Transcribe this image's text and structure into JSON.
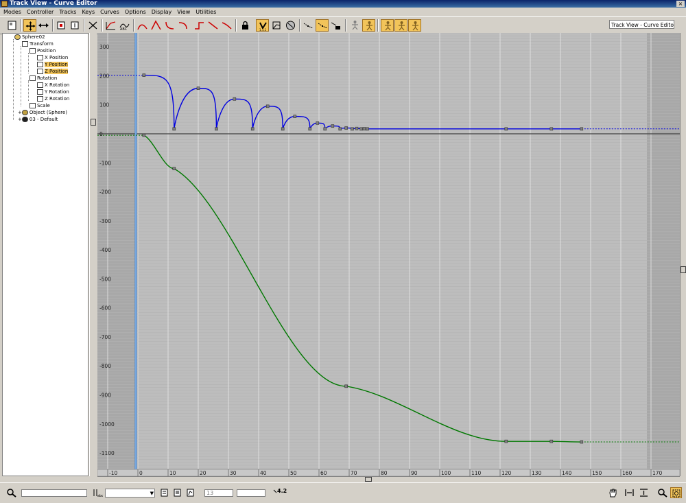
{
  "window": {
    "title": "Track View - Curve Editor",
    "close_glyph": "×"
  },
  "menu": [
    "Modes",
    "Controller",
    "Tracks",
    "Keys",
    "Curves",
    "Options",
    "Display",
    "View",
    "Utilities"
  ],
  "toolbar": {
    "view_name": "Track View - Curve Editor"
  },
  "tree": {
    "nodes": [
      {
        "label": "Sphere02",
        "icon": "object-icon"
      },
      {
        "label": "Transform",
        "icon": "transform-icon"
      },
      {
        "label": "Position",
        "icon": "position-icon"
      },
      {
        "label": "X Position",
        "icon": "track-icon"
      },
      {
        "label": "Y Position",
        "icon": "track-icon",
        "selected": true
      },
      {
        "label": "Z Position",
        "icon": "track-icon",
        "selected": true
      },
      {
        "label": "Rotation",
        "icon": "rotation-icon"
      },
      {
        "label": "X Rotation",
        "icon": "track-icon"
      },
      {
        "label": "Y Rotation",
        "icon": "track-icon"
      },
      {
        "label": "Z Rotation",
        "icon": "track-icon"
      },
      {
        "label": "Scale",
        "icon": "scale-icon"
      },
      {
        "label": "Object (Sphere)",
        "icon": "sphere-icon"
      },
      {
        "label": "03 - Default",
        "icon": "material-icon"
      }
    ]
  },
  "graph": {
    "x_ticks": [
      -10,
      0,
      10,
      20,
      30,
      40,
      50,
      60,
      70,
      80,
      90,
      100,
      110,
      120,
      130,
      140,
      150,
      160,
      170
    ],
    "y_ticks": [
      300,
      200,
      100,
      0,
      -100,
      -200,
      -300,
      -400,
      -500,
      -600,
      -700,
      -800,
      -900,
      -1000,
      -1100
    ],
    "current_frame": 0,
    "active_range": [
      0,
      170
    ],
    "colors": {
      "z_curve": "#0000e0",
      "y_curve": "#007800",
      "time_slider": "#3a7fd0",
      "grid": "#e8e8e8",
      "background": "#bdbdbd"
    },
    "z_position_keys": [
      [
        2,
        202
      ],
      [
        12,
        17
      ],
      [
        20,
        157
      ],
      [
        26,
        17
      ],
      [
        32,
        120
      ],
      [
        38,
        17
      ],
      [
        43,
        95
      ],
      [
        48,
        17
      ],
      [
        52,
        60
      ],
      [
        57,
        17
      ],
      [
        59.5,
        37
      ],
      [
        62,
        17
      ],
      [
        64.5,
        27
      ],
      [
        67,
        17
      ],
      [
        69,
        20
      ],
      [
        71,
        17
      ],
      [
        72.5,
        18.5
      ],
      [
        74,
        17
      ],
      [
        75,
        17.5
      ],
      [
        76,
        17
      ],
      [
        122,
        17
      ],
      [
        137,
        17
      ],
      [
        147,
        17
      ]
    ],
    "y_position_keys": [
      [
        2,
        -5
      ],
      [
        12,
        -120
      ],
      [
        69,
        -870
      ],
      [
        122,
        -1060
      ],
      [
        137,
        -1060
      ],
      [
        147,
        -1062
      ]
    ]
  },
  "status": {
    "frame_field": "13",
    "value_field": "",
    "precision": "4.2"
  }
}
